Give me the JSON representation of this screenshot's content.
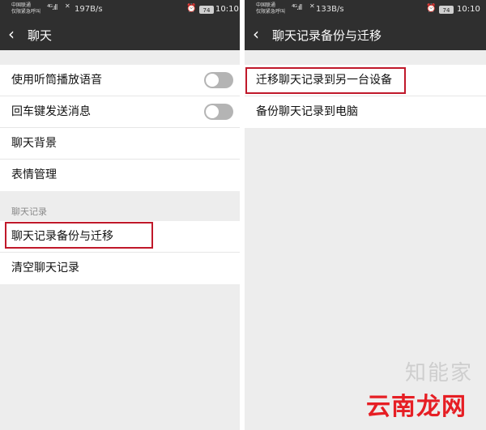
{
  "left": {
    "status": {
      "carrier_line1": "中国联通",
      "carrier_line2": "仅限紧急呼叫",
      "signal": "⁴ᴳ.ıll",
      "no_sim": "✕",
      "speed": "197B/s",
      "alarm": "⏰",
      "battery": "74",
      "time": "10:10"
    },
    "header": {
      "back": "‹",
      "title": "聊天"
    },
    "settings": [
      {
        "label": "使用听筒播放语音",
        "toggle": false
      },
      {
        "label": "回车键发送消息",
        "toggle": false
      },
      {
        "label": "聊天背景"
      },
      {
        "label": "表情管理"
      }
    ],
    "section_title": "聊天记录",
    "history_items": [
      {
        "label": "聊天记录备份与迁移"
      },
      {
        "label": "清空聊天记录"
      }
    ]
  },
  "right": {
    "status": {
      "carrier_line1": "中国联通",
      "carrier_line2": "仅限紧急呼叫",
      "signal": "⁴ᴳ.ıll",
      "no_sim": "✕",
      "speed": "133B/s",
      "alarm": "⏰",
      "battery": "74",
      "time": "10:10"
    },
    "header": {
      "back": "‹",
      "title": "聊天记录备份与迁移"
    },
    "items": [
      {
        "label": "迁移聊天记录到另一台设备"
      },
      {
        "label": "备份聊天记录到电脑"
      }
    ]
  },
  "watermark": {
    "text": "知能家",
    "brand": "云南龙网"
  },
  "colors": {
    "status_bar": "#2f2f2f",
    "background": "#ededed",
    "highlight_box": "#c0182a",
    "brand_red": "#e61e24"
  }
}
